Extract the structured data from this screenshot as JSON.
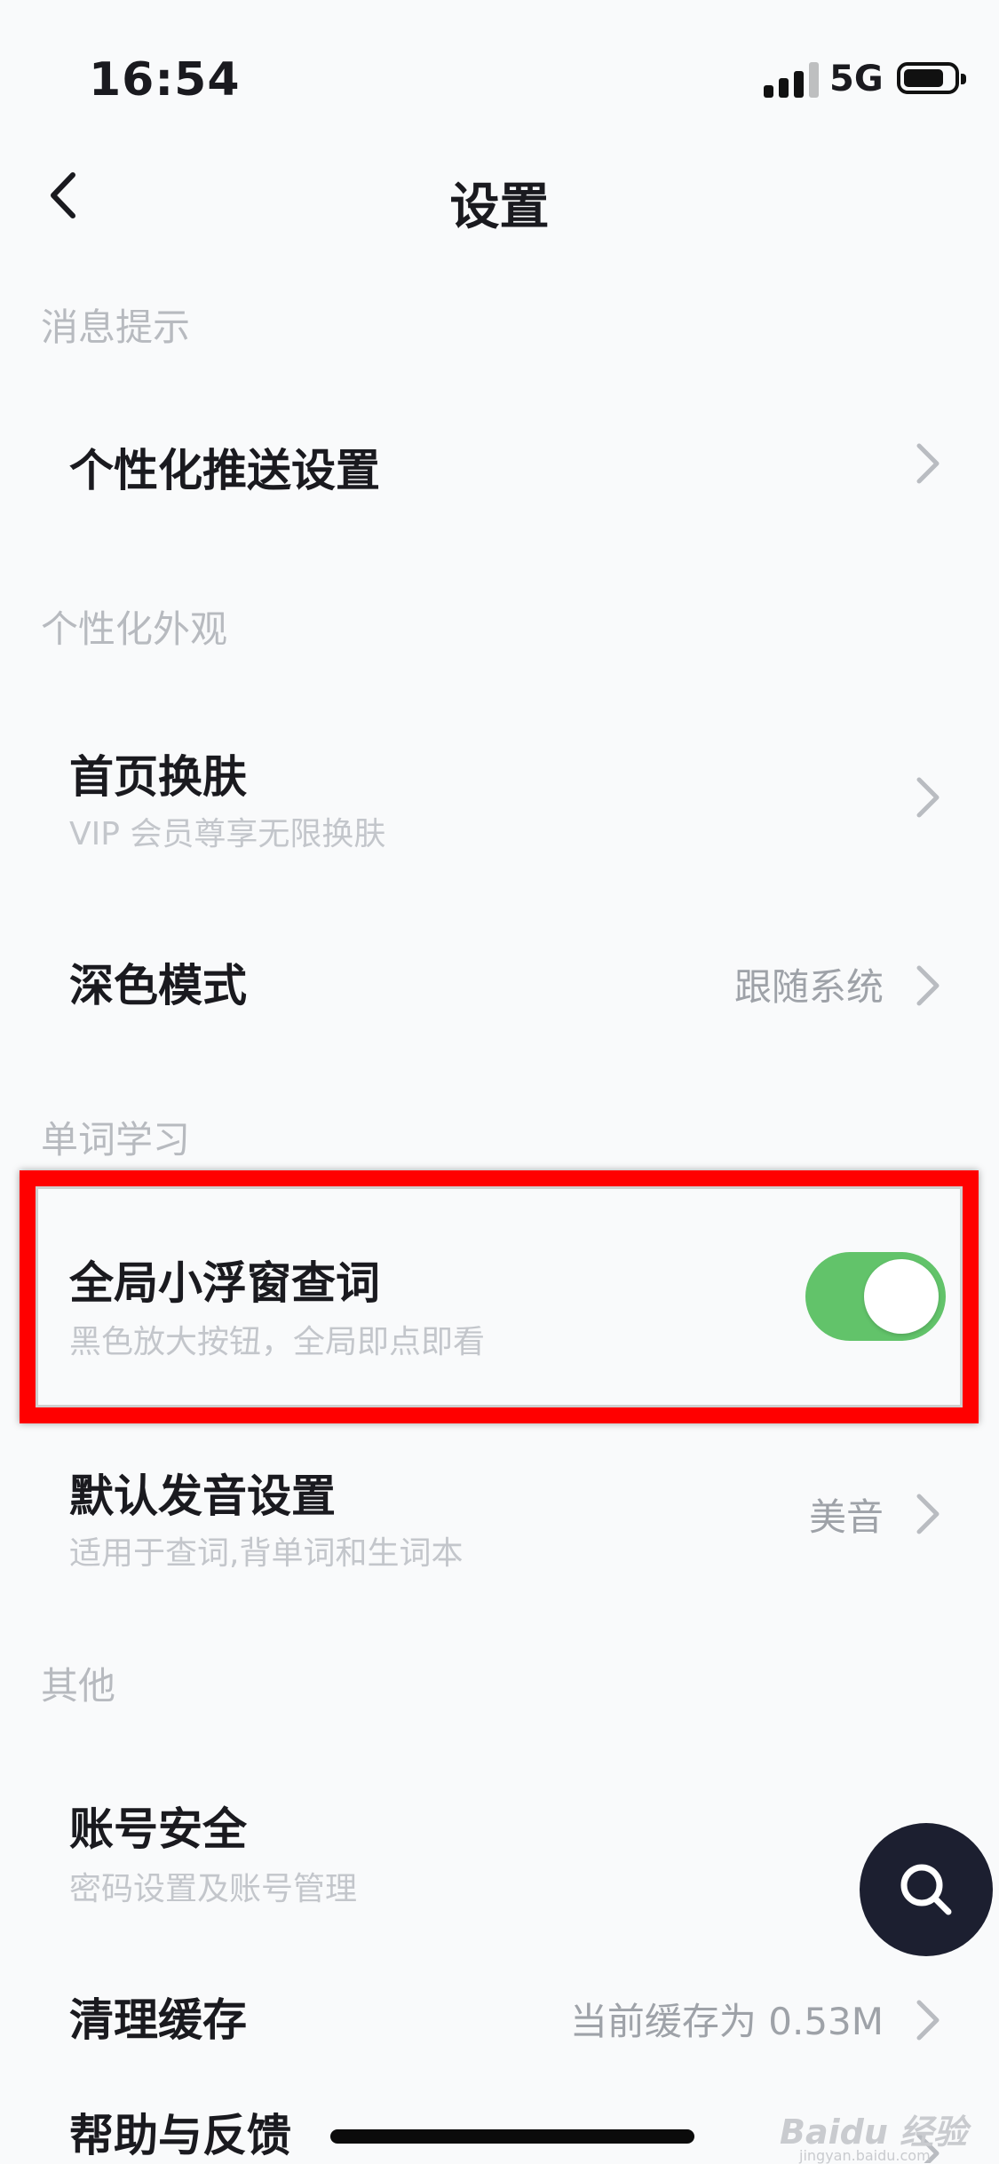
{
  "status_bar": {
    "time": "16:54",
    "network": "5G"
  },
  "nav": {
    "title": "设置",
    "back_icon": "chevron-left-icon"
  },
  "sections": [
    {
      "header": "消息提示"
    },
    {
      "header": "个性化外观"
    },
    {
      "header": "单词学习"
    },
    {
      "header": "其他"
    }
  ],
  "items": {
    "push": {
      "title": "个性化推送设置"
    },
    "skin": {
      "title": "首页换肤",
      "subtitle": "VIP 会员尊享无限换肤"
    },
    "dark_mode": {
      "title": "深色模式",
      "value": "跟随系统"
    },
    "float_lookup": {
      "title": "全局小浮窗查词",
      "subtitle": "黑色放大按钮，全局即点即看",
      "enabled": true
    },
    "pronunciation": {
      "title": "默认发音设置",
      "subtitle": "适用于查词,背单词和生词本",
      "value": "美音"
    },
    "account": {
      "title": "账号安全",
      "subtitle": "密码设置及账号管理"
    },
    "cache": {
      "title": "清理缓存",
      "value": "当前缓存为 0.53M"
    },
    "help": {
      "title": "帮助与反馈"
    }
  },
  "fab": {
    "icon": "search-icon"
  },
  "watermark": {
    "text": "Baidu 经验",
    "sub": "jingyan.baidu.com"
  },
  "colors": {
    "toggle_on": "#62c36a",
    "highlight": "#ff0000",
    "fab_bg": "#1c1f30"
  }
}
